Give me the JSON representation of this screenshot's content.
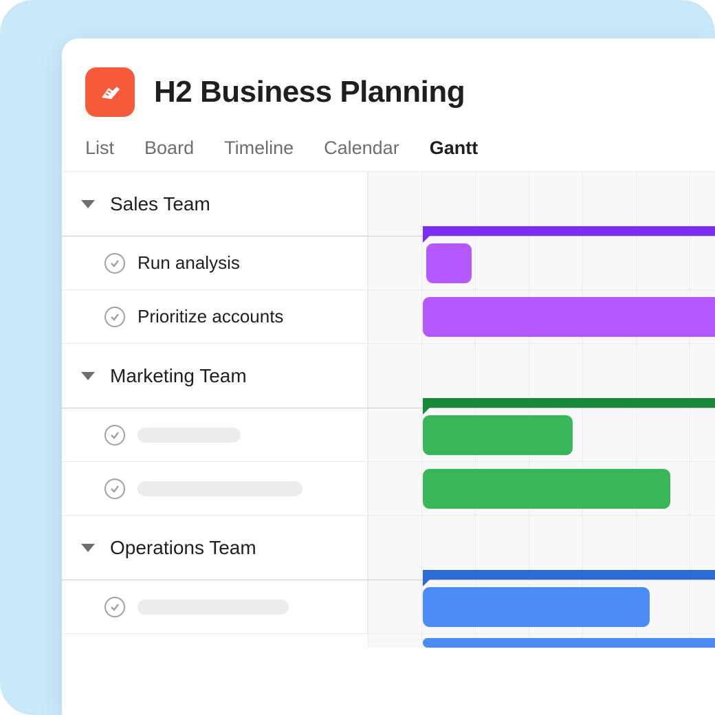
{
  "project": {
    "title": "H2 Business Planning"
  },
  "tabs": {
    "list": "List",
    "board": "Board",
    "timeline": "Timeline",
    "calendar": "Calendar",
    "gantt": "Gantt",
    "active": "gantt"
  },
  "chart_data": {
    "type": "gantt",
    "columns_visible": 6,
    "sections": [
      {
        "name": "Sales Team",
        "summary": {
          "start": 1,
          "end": 6,
          "color": "#7b2ff5"
        },
        "tasks": [
          {
            "label": "Run analysis",
            "start": 1,
            "end": 2,
            "color": "#b558ff"
          },
          {
            "label": "Prioritize accounts",
            "start": 1,
            "end": 6,
            "color": "#b558ff"
          }
        ]
      },
      {
        "name": "Marketing Team",
        "summary": {
          "start": 1,
          "end": 6,
          "color": "#178a3a"
        },
        "tasks": [
          {
            "label": "",
            "start": 1,
            "end": 4,
            "color": "#39b55a"
          },
          {
            "label": "",
            "start": 1,
            "end": 5.2,
            "color": "#39b55a"
          }
        ]
      },
      {
        "name": "Operations Team",
        "summary": {
          "start": 1,
          "end": 6,
          "color": "#2a6bd6"
        },
        "tasks": [
          {
            "label": "",
            "start": 1,
            "end": 4.5,
            "color": "#4a8bf6"
          }
        ]
      }
    ]
  }
}
